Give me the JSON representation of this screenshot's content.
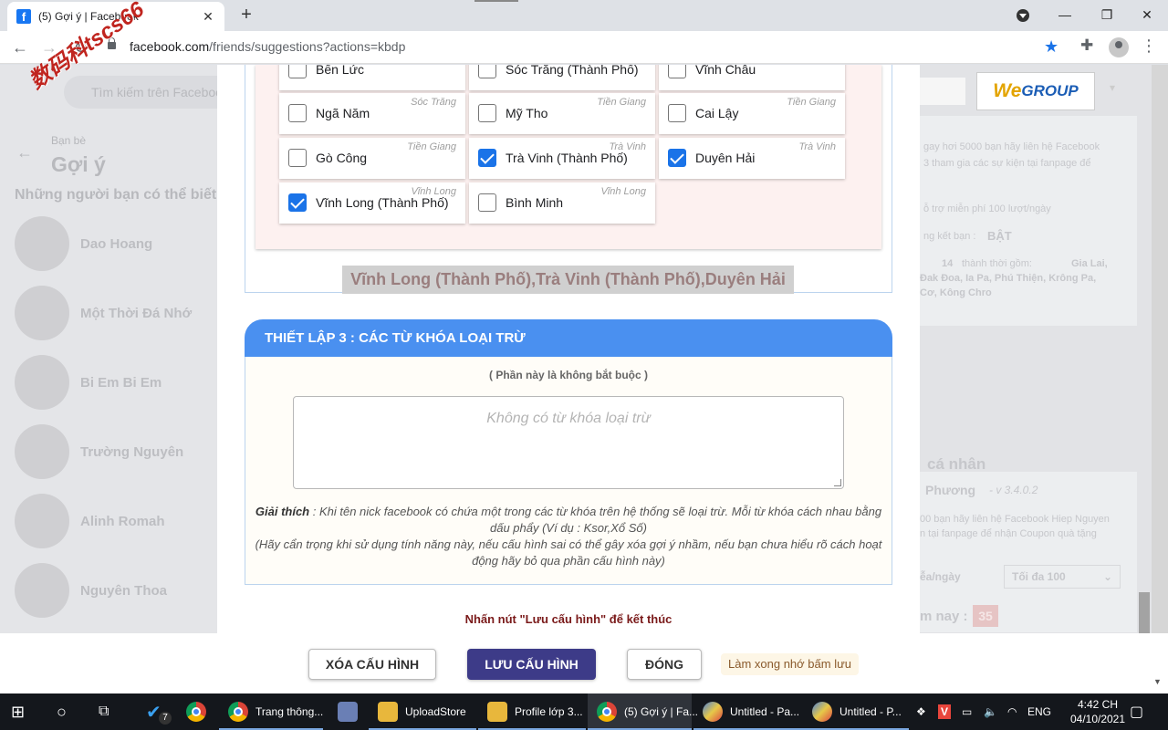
{
  "browser": {
    "tab_title": "(5) Gợi ý | Facebook",
    "tab_favicon": "f",
    "new_tab": "+",
    "url_host": "facebook.com",
    "url_path": "/friends/suggestions?actions=kbdp"
  },
  "watermark": "数码科tscs66",
  "facebook": {
    "search_placeholder": "Tìm kiếm trên Facebook",
    "breadcrumb": "Bạn bè",
    "heading": "Gợi ý",
    "subheading": "Những người bạn có thể biết",
    "friends": [
      "Dao Hoang",
      "Một Thời Đá Nhớ",
      "Bi Em Bi Em",
      "Trường Nguyên",
      "Alinh Romah",
      "Nguyên Thoa"
    ]
  },
  "side_panel": {
    "logo_we": "We",
    "logo_group": "GROUP",
    "line1": "gay hơi 5000 bạn hãy liên hệ Facebook",
    "line2": "3 tham gia các sự kiện tại fanpage để",
    "line3": "ỗ trợ miễn phí 100 lượt/ngày",
    "line4_label": "ng kết bạn :",
    "line4_value": "BẬT",
    "line5_a": "14",
    "line5_b": "Gia Lai,",
    "line5_mid": "thành thời gồm:",
    "line6": "Đak Đoa, Ia Pa, Phú Thiện, Krông Pa,",
    "line7": "Cơ, Kông Chro",
    "section_title": "cá nhân",
    "version_name": "Phương",
    "version": "- v 3.4.0.2",
    "note1": "00 bạn hãy liên hệ Facebook Hiep Nguyen",
    "note2": "n tại fanpage để nhận Coupon quà tặng",
    "limit_label": "ễa/ngày",
    "limit_value": "Tối đa 100",
    "today_label": "m nay :",
    "today_count": "35"
  },
  "cities": [
    {
      "name": "Bến Lức",
      "province": "",
      "checked": false
    },
    {
      "name": "Sóc Trăng (Thành Phố)",
      "province": "",
      "checked": false
    },
    {
      "name": "Vĩnh Châu",
      "province": "",
      "checked": false
    },
    {
      "name": "Ngã Năm",
      "province": "Sóc Trăng",
      "checked": false
    },
    {
      "name": "Mỹ Tho",
      "province": "Tiền Giang",
      "checked": false
    },
    {
      "name": "Cai Lậy",
      "province": "Tiền Giang",
      "checked": false
    },
    {
      "name": "Gò Công",
      "province": "Tiền Giang",
      "checked": false
    },
    {
      "name": "Trà Vinh (Thành Phố)",
      "province": "Trà Vinh",
      "checked": true
    },
    {
      "name": "Duyên Hải",
      "province": "Trà Vinh",
      "checked": true
    },
    {
      "name": "Vĩnh Long (Thành Phố)",
      "province": "Vĩnh Long",
      "checked": true
    },
    {
      "name": "Bình Minh",
      "province": "Vĩnh Long",
      "checked": false
    }
  ],
  "selected_summary": "Vĩnh Long (Thành Phố),Trà Vinh (Thành Phố),Duyên Hải",
  "section3": {
    "title": "THIẾT LẬP 3 : CÁC TỪ KHÓA LOẠI TRỪ",
    "optional": "( Phần này là không bắt buộc )",
    "placeholder": "Không có từ khóa loại trừ",
    "explain_label": "Giải thích",
    "explain_text": " : Khi tên nick facebook có chứa một trong các từ khóa trên hệ thống sẽ loại trừ. Mỗi từ khóa cách nhau bằng dấu phẩy (Ví dụ : Ksor,Xổ Số)",
    "warning": "(Hãy cẩn trọng khi sử dụng tính năng này, nếu cấu hình sai có thể gây xóa gợi ý nhầm, nếu bạn chưa hiểu rõ cách hoạt động hãy bỏ qua phần cấu hình này)"
  },
  "final_note": "Nhấn nút \"Lưu cấu hình\" để kết thúc",
  "footer": {
    "delete_label": "XÓA CẤU HÌNH",
    "save_label": "LƯU CẤU HÌNH",
    "close_label": "ĐÓNG",
    "hint": "Làm xong nhớ bấm lưu"
  },
  "taskbar": {
    "badge": "7",
    "items": [
      "Trang thông...",
      "UploadStore",
      "Profile lớp 3...",
      "(5) Gợi ý | Fa...",
      "Untitled - Pa...",
      "Untitled - P..."
    ],
    "lang": "ENG",
    "time": "4:42 CH",
    "date": "04/10/2021"
  },
  "colors": {
    "section_header": "#4a90f0",
    "save_button": "#3d3b88",
    "checkbox_on": "#1a73e8"
  }
}
